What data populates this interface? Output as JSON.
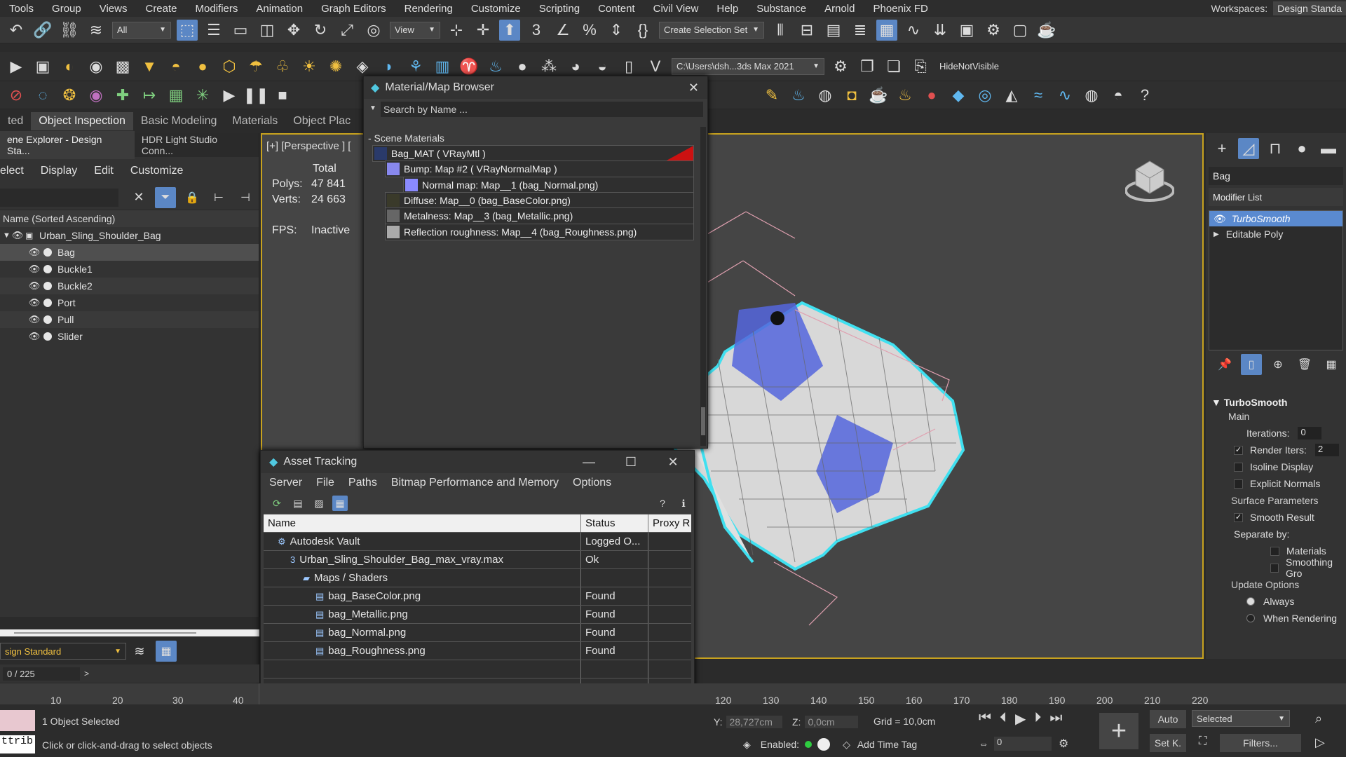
{
  "menu": [
    "Tools",
    "Group",
    "Views",
    "Create",
    "Modifiers",
    "Animation",
    "Graph Editors",
    "Rendering",
    "Customize",
    "Scripting",
    "Content",
    "Civil View",
    "Help",
    "Substance",
    "Arnold",
    "Phoenix FD"
  ],
  "workspace": {
    "label": "Workspaces:",
    "value": "Design Standa"
  },
  "toolbar": {
    "filter_value": "All",
    "view_value": "View",
    "selection_set": "Create Selection Set",
    "path_value": "C:\\Users\\dsh...3ds Max 2021",
    "hide_label": "HideNotVisible"
  },
  "ribbon_tabs": [
    "ted",
    "Object Inspection",
    "Basic Modeling",
    "Materials",
    "Object Plac"
  ],
  "scene": {
    "tabs": [
      "ene Explorer - Design Sta...",
      "HDR Light Studio Conn..."
    ],
    "menu": [
      "elect",
      "Display",
      "Edit",
      "Customize"
    ],
    "column_header": "Name (Sorted Ascending)",
    "root": "Urban_Sling_Shoulder_Bag",
    "objects": [
      "Bag",
      "Buckle1",
      "Buckle2",
      "Port",
      "Pull",
      "Slider"
    ],
    "layer": "sign Standard",
    "frame": "0 / 225"
  },
  "viewport": {
    "label": "[+] [Perspective ] [",
    "total_label": "Total",
    "polys_label": "Polys:",
    "polys": "47 841",
    "verts_label": "Verts:",
    "verts": "24 663",
    "fps_label": "FPS:",
    "fps": "Inactive"
  },
  "material_browser": {
    "title": "Material/Map Browser",
    "search_placeholder": "Search by Name ...",
    "section": "- Scene Materials",
    "items": [
      {
        "label": "Bag_MAT  ( VRayMtl )",
        "level": 0,
        "color": "#2a3a6a"
      },
      {
        "label": "Bump: Map #2  ( VRayNormalMap )",
        "level": 1,
        "color": "#8888ee"
      },
      {
        "label": "Normal map: Map__1 (bag_Normal.png)",
        "level": 2,
        "color": "#8a8aff"
      },
      {
        "label": "Diffuse: Map__0 (bag_BaseColor.png)",
        "level": 1,
        "color": "#3a3a2a"
      },
      {
        "label": "Metalness: Map__3 (bag_Metallic.png)",
        "level": 1,
        "color": "#666"
      },
      {
        "label": "Reflection roughness: Map__4 (bag_Roughness.png)",
        "level": 1,
        "color": "#aaa"
      }
    ]
  },
  "asset_tracking": {
    "title": "Asset Tracking",
    "menu": [
      "Server",
      "File",
      "Paths",
      "Bitmap Performance and Memory",
      "Options"
    ],
    "headers": [
      "Name",
      "Status",
      "Proxy R"
    ],
    "rows": [
      {
        "name": "Autodesk Vault",
        "status": "Logged O...",
        "level": 0,
        "icon": "vault-icon"
      },
      {
        "name": "Urban_Sling_Shoulder_Bag_max_vray.max",
        "status": "Ok",
        "level": 1,
        "icon": "max-file-icon"
      },
      {
        "name": "Maps / Shaders",
        "status": "",
        "level": 2,
        "icon": "folder-icon"
      },
      {
        "name": "bag_BaseColor.png",
        "status": "Found",
        "level": 3,
        "icon": "image-file-icon"
      },
      {
        "name": "bag_Metallic.png",
        "status": "Found",
        "level": 3,
        "icon": "image-file-icon"
      },
      {
        "name": "bag_Normal.png",
        "status": "Found",
        "level": 3,
        "icon": "image-file-icon"
      },
      {
        "name": "bag_Roughness.png",
        "status": "Found",
        "level": 3,
        "icon": "image-file-icon"
      }
    ]
  },
  "command_panel": {
    "object_name": "Bag",
    "modifier_list": "Modifier List",
    "stack": [
      "TurboSmooth",
      "Editable Poly"
    ],
    "rollout": "TurboSmooth",
    "main_label": "Main",
    "iterations_label": "Iterations:",
    "iterations": "0",
    "render_iters_label": "Render Iters:",
    "render_iters": "2",
    "isoline": "Isoline Display",
    "explicit": "Explicit Normals",
    "surface_label": "Surface Parameters",
    "smooth_result": "Smooth Result",
    "separate_label": "Separate by:",
    "materials": "Materials",
    "smoothing": "Smoothing Gro",
    "update_label": "Update Options",
    "always": "Always",
    "when_rendering": "When Rendering"
  },
  "timeline": {
    "ticks_left": [
      "10",
      "20",
      "30",
      "40"
    ],
    "ticks_right": [
      "120",
      "130",
      "140",
      "150",
      "160",
      "170",
      "180",
      "190",
      "200",
      "210",
      "220"
    ]
  },
  "status": {
    "selected": "1 Object Selected",
    "hint": "Click or click-and-drag to select objects",
    "y_label": "Y:",
    "y_value": "28,727cm",
    "z_label": "Z:",
    "z_value": "0,0cm",
    "grid": "Grid = 10,0cm",
    "enabled": "Enabled:",
    "add_time_tag": "Add Time Tag",
    "auto": "Auto",
    "selected_dd": "Selected",
    "setk": "Set K.",
    "filters": "Filters...",
    "frame": "0",
    "attrib": "ttrib"
  }
}
